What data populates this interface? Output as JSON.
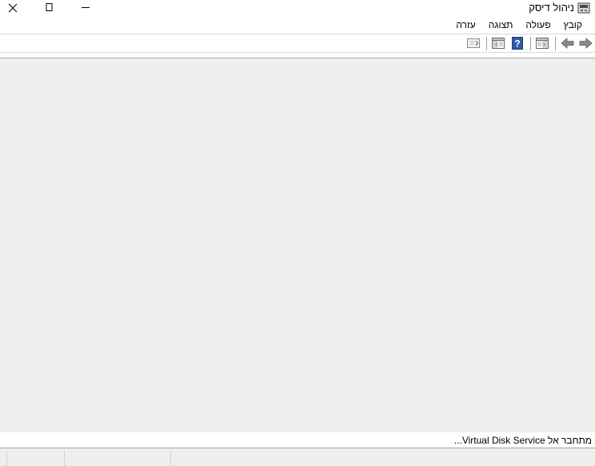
{
  "window": {
    "title": "ניהול דיסק",
    "icons": {
      "app": "disk-management-icon",
      "close": "close-icon",
      "restore": "restore-icon",
      "minimize": "minimize-icon"
    }
  },
  "menu": {
    "items": [
      {
        "label": "קובץ"
      },
      {
        "label": "פעולה"
      },
      {
        "label": "תצוגה"
      },
      {
        "label": "עזרה"
      }
    ]
  },
  "toolbar": {
    "icons": [
      "forward-icon",
      "back-icon",
      "show-hide-console-tree-icon",
      "help-icon",
      "properties-icon",
      "export-list-icon"
    ]
  },
  "status": {
    "message": "מתחבר אל Virtual Disk Service..."
  }
}
